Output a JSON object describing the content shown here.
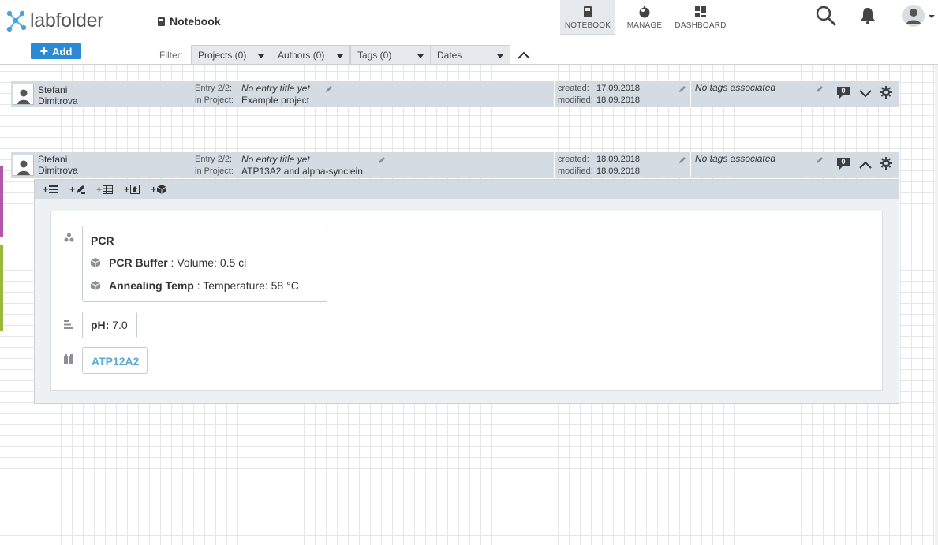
{
  "app": {
    "logo_text": "labfolder",
    "page_title": "Notebook",
    "brand_color": "#2a8ad4"
  },
  "nav": [
    {
      "label": "NOTEBOOK",
      "icon": "notebook-icon",
      "active": true
    },
    {
      "label": "MANAGE",
      "icon": "manage-icon",
      "active": false
    },
    {
      "label": "DASHBOARD",
      "icon": "dashboard-icon",
      "active": false
    }
  ],
  "actions": {
    "add_label": "Add"
  },
  "filter": {
    "label": "Filter:",
    "options": [
      "Projects (0)",
      "Authors (0)",
      "Tags (0)",
      "Dates"
    ]
  },
  "entries": [
    {
      "author_first": "Stefani",
      "author_last": "Dimitrova",
      "entry_label": "Entry 2/2:",
      "entry_title": "No entry title yet",
      "project_label": "in Project:",
      "project": "Example project",
      "created_label": "created:",
      "created": "17.09.2018",
      "modified_label": "modified:",
      "modified": "18.09.2018",
      "tags": "No tags associated",
      "comments": "0",
      "expanded": false
    },
    {
      "author_first": "Stefani",
      "author_last": "Dimitrova",
      "entry_label": "Entry 2/2:",
      "entry_title": "No entry title yet",
      "project_label": "in Project:",
      "project": "ATP13A2 and alpha-synclein",
      "created_label": "created:",
      "created": "18.09.2018",
      "modified_label": "modified:",
      "modified": "18.09.2018",
      "tags": "No tags associated",
      "comments": "0",
      "expanded": true
    }
  ],
  "content": {
    "group_title": "PCR",
    "items": [
      {
        "name": "PCR Buffer",
        "value": " : Volume: 0.5 cl"
      },
      {
        "name": "Annealing Temp",
        "value": " : Temperature: 58 °C"
      }
    ],
    "ph_label": "pH:",
    "ph_value": " 7.0",
    "link_label": "ATP12A2"
  }
}
